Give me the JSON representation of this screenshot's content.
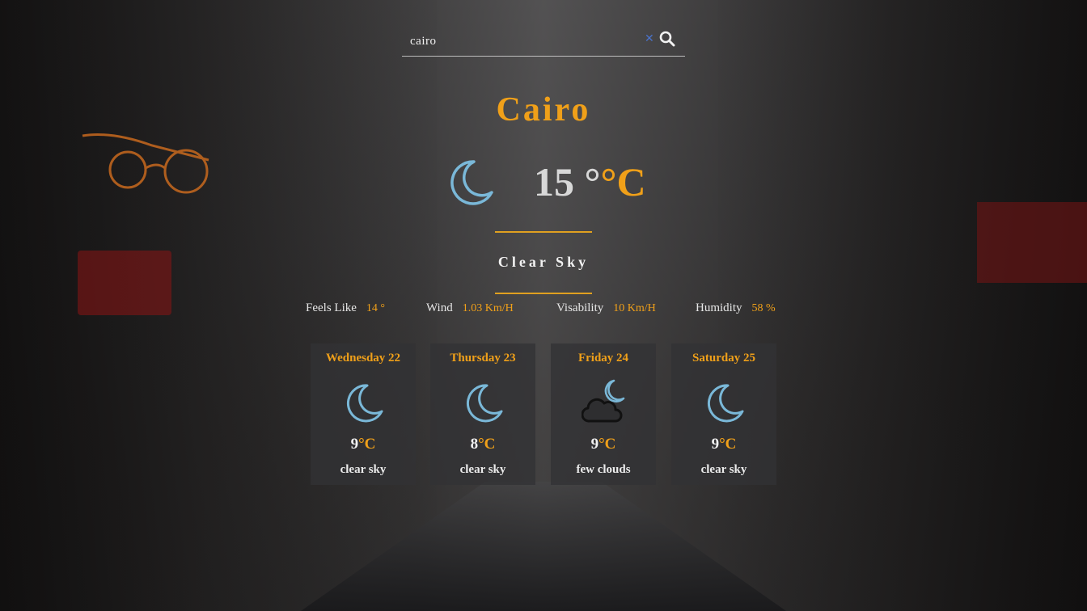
{
  "search": {
    "value": "cairo",
    "placeholder": ""
  },
  "current": {
    "city": "Cairo",
    "icon": "moon-icon",
    "temperature": "15 °",
    "unit": "°C",
    "description": "Clear Sky"
  },
  "details": [
    {
      "label": "Feels Like",
      "value": "14 °"
    },
    {
      "label": "Wind",
      "value": "1.03 Km/H"
    },
    {
      "label": "Visability",
      "value": "10 Km/H"
    },
    {
      "label": "Humidity",
      "value": "58 %"
    }
  ],
  "forecast": [
    {
      "day": "Wednesday 22",
      "icon": "moon-icon",
      "temp": "9",
      "unit": "°C",
      "desc": "clear sky"
    },
    {
      "day": "Thursday 23",
      "icon": "moon-icon",
      "temp": "8",
      "unit": "°C",
      "desc": "clear sky"
    },
    {
      "day": "Friday 24",
      "icon": "cloud-moon-icon",
      "temp": "9",
      "unit": "°C",
      "desc": "few clouds"
    },
    {
      "day": "Saturday 25",
      "icon": "moon-icon",
      "temp": "9",
      "unit": "°C",
      "desc": "clear sky"
    }
  ],
  "colors": {
    "accent": "#f0a019",
    "icon_blue": "#7ab8d8",
    "text_light": "#f2f2f2"
  }
}
